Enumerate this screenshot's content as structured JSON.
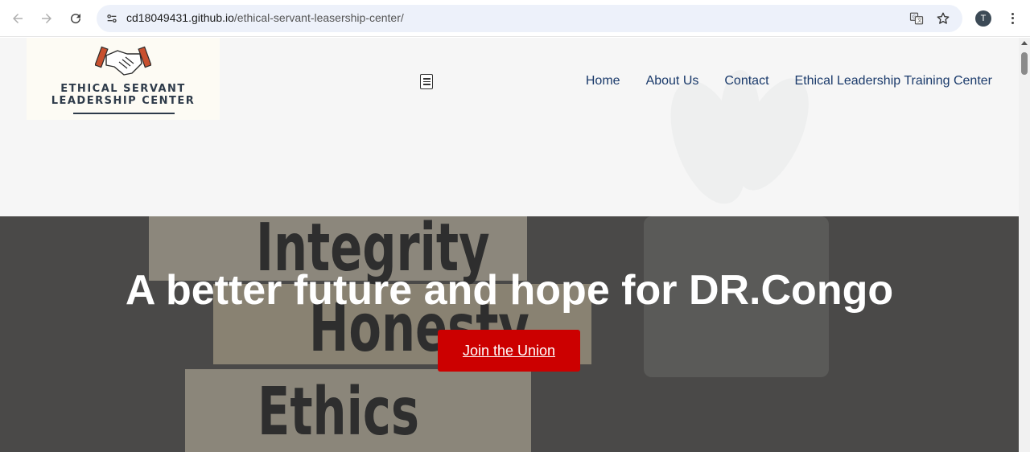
{
  "browser": {
    "url_domain": "cd18049431.github.io",
    "url_path": "/ethical-servant-leasership-center/",
    "profile_initial": "T",
    "icons": [
      "back-arrow-icon",
      "forward-arrow-icon",
      "reload-icon",
      "site-info-icon",
      "translate-icon",
      "bookmark-star-icon",
      "more-menu-icon"
    ]
  },
  "logo": {
    "line1": "ETHICAL SERVANT",
    "line2": "LEADERSHIP CENTER",
    "icon": "handshake-icon"
  },
  "nav": {
    "items": [
      {
        "label": "Home"
      },
      {
        "label": "About Us"
      },
      {
        "label": "Contact"
      },
      {
        "label": "Ethical Leadership Training Center"
      }
    ]
  },
  "hero": {
    "title": "A better future and hope for DR.Congo",
    "cta_label": "Join the Union",
    "background_words": [
      "Integrity",
      "Honesty",
      "Ethics"
    ]
  },
  "colors": {
    "accent_red": "#cc0000",
    "nav_text": "#1a3a6b",
    "header_bg": "#f6f6f6"
  }
}
